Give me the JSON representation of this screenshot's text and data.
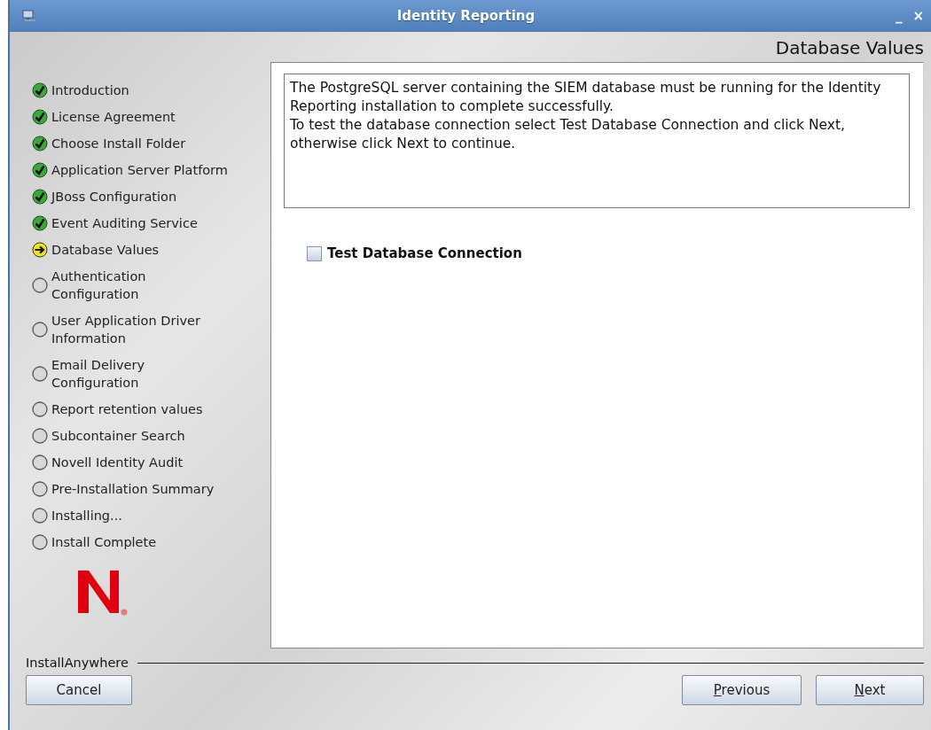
{
  "window": {
    "title": "Identity Reporting",
    "controls": [
      "_",
      "×"
    ]
  },
  "header": {
    "title": "Database Values"
  },
  "steps": [
    {
      "label": "Introduction",
      "kind": "done"
    },
    {
      "label": "License Agreement",
      "kind": "done"
    },
    {
      "label": "Choose Install Folder",
      "kind": "done"
    },
    {
      "label": "Application Server Platform",
      "kind": "done"
    },
    {
      "label": "JBoss Configuration",
      "kind": "done"
    },
    {
      "label": "Event Auditing Service",
      "kind": "done"
    },
    {
      "label": "Database Values",
      "kind": "current"
    },
    {
      "label": "Authentication Configuration",
      "kind": "pending"
    },
    {
      "label": "User Application Driver Information",
      "kind": "pending"
    },
    {
      "label": "Email Delivery Configuration",
      "kind": "pending"
    },
    {
      "label": "Report retention values",
      "kind": "pending"
    },
    {
      "label": "Subcontainer Search",
      "kind": "pending"
    },
    {
      "label": "Novell Identity Audit",
      "kind": "pending"
    },
    {
      "label": "Pre-Installation Summary",
      "kind": "pending"
    },
    {
      "label": "Installing...",
      "kind": "pending"
    },
    {
      "label": "Install Complete",
      "kind": "pending"
    }
  ],
  "description": [
    "The PostgreSQL server containing the SIEM database must be running for the Identity Reporting installation to complete successfully.",
    "To test the database connection select Test Database Connection and click Next, otherwise click Next to continue."
  ],
  "test_connection": {
    "label": "Test Database Connection",
    "checked": false
  },
  "footer": {
    "brand": "InstallAnywhere",
    "left_buttons": [
      {
        "label": "Cancel",
        "underline_first": false
      }
    ],
    "right_buttons": [
      {
        "label": "Previous",
        "underline_first": true
      },
      {
        "label": "Next",
        "underline_first": true
      }
    ]
  }
}
